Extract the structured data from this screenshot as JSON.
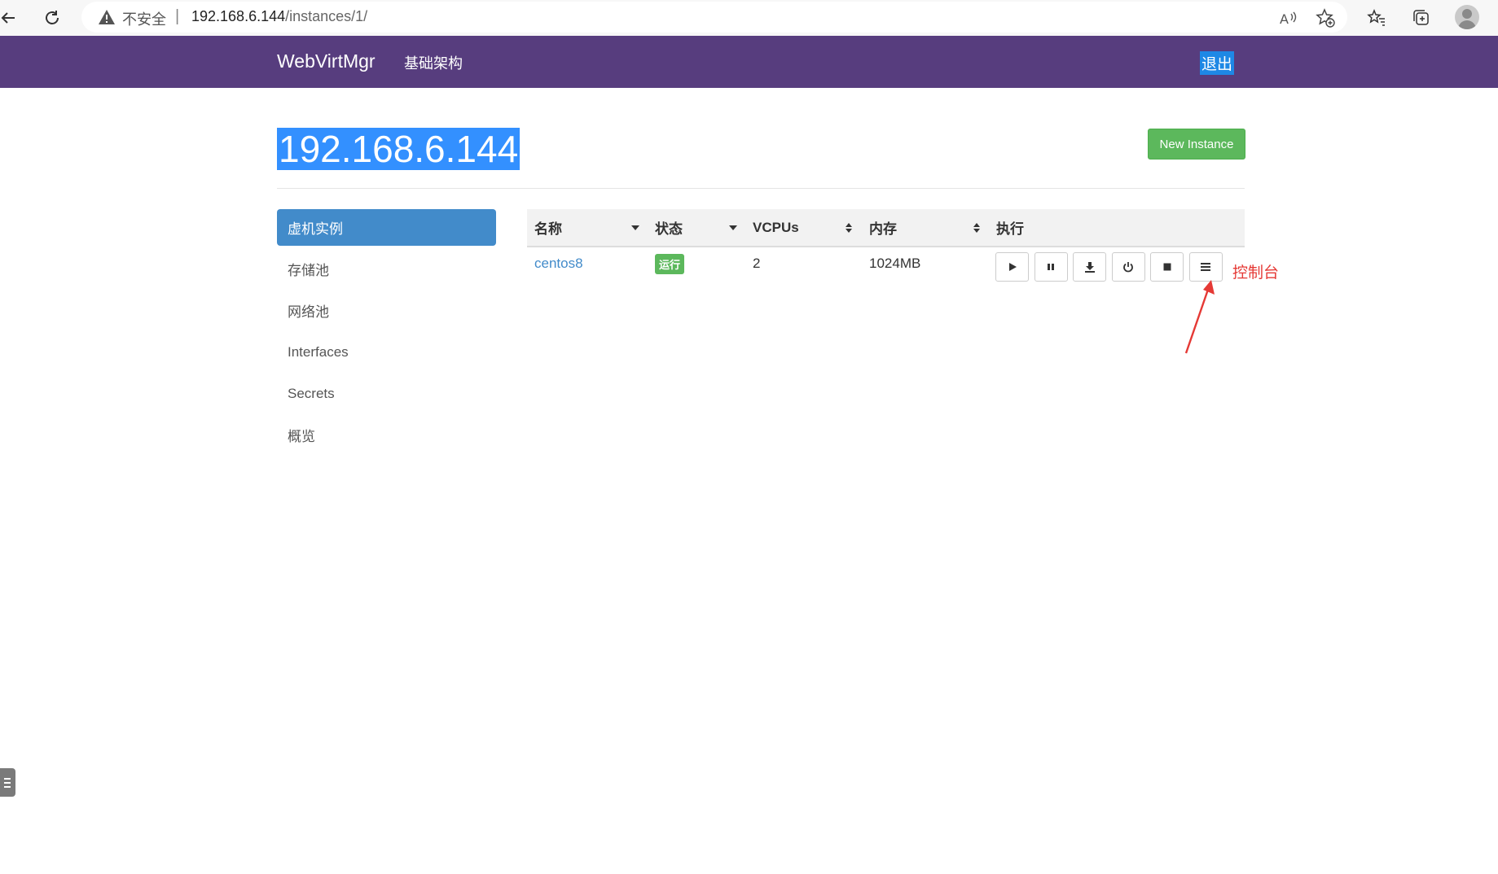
{
  "browser": {
    "insecure_label": "不安全",
    "url_host": "192.168.6.144",
    "url_path": "/instances/1/",
    "icons": [
      "back-icon",
      "refresh-icon",
      "warning-icon",
      "read-aloud-icon",
      "add-favorite-icon",
      "favorites-icon",
      "collections-icon",
      "profile-icon"
    ]
  },
  "navbar": {
    "brand": "WebVirtMgr",
    "link": "基础架构",
    "logout": "退出",
    "background": "#573d7e"
  },
  "header": {
    "title": "192.168.6.144",
    "new_instance": "New Instance"
  },
  "sidebar": {
    "items": [
      {
        "label": "虚机实例",
        "active": true
      },
      {
        "label": "存储池"
      },
      {
        "label": "网络池"
      },
      {
        "label": "Interfaces"
      },
      {
        "label": "Secrets"
      },
      {
        "label": "概览"
      }
    ]
  },
  "table": {
    "columns": [
      {
        "label": "名称"
      },
      {
        "label": "状态"
      },
      {
        "label": "VCPUs"
      },
      {
        "label": "内存"
      },
      {
        "label": "执行"
      }
    ],
    "rows": [
      {
        "name": "centos8",
        "status": "运行",
        "vcpus": "2",
        "memory": "1024MB"
      }
    ],
    "actions": [
      "play-icon",
      "pause-icon",
      "download-icon",
      "power-icon",
      "stop-icon",
      "console-icon"
    ]
  },
  "annotation": {
    "label": "控制台",
    "color": "#e53935"
  },
  "colors": {
    "primary": "#428bca",
    "success": "#5cb85c",
    "selection": "#3390ff"
  }
}
